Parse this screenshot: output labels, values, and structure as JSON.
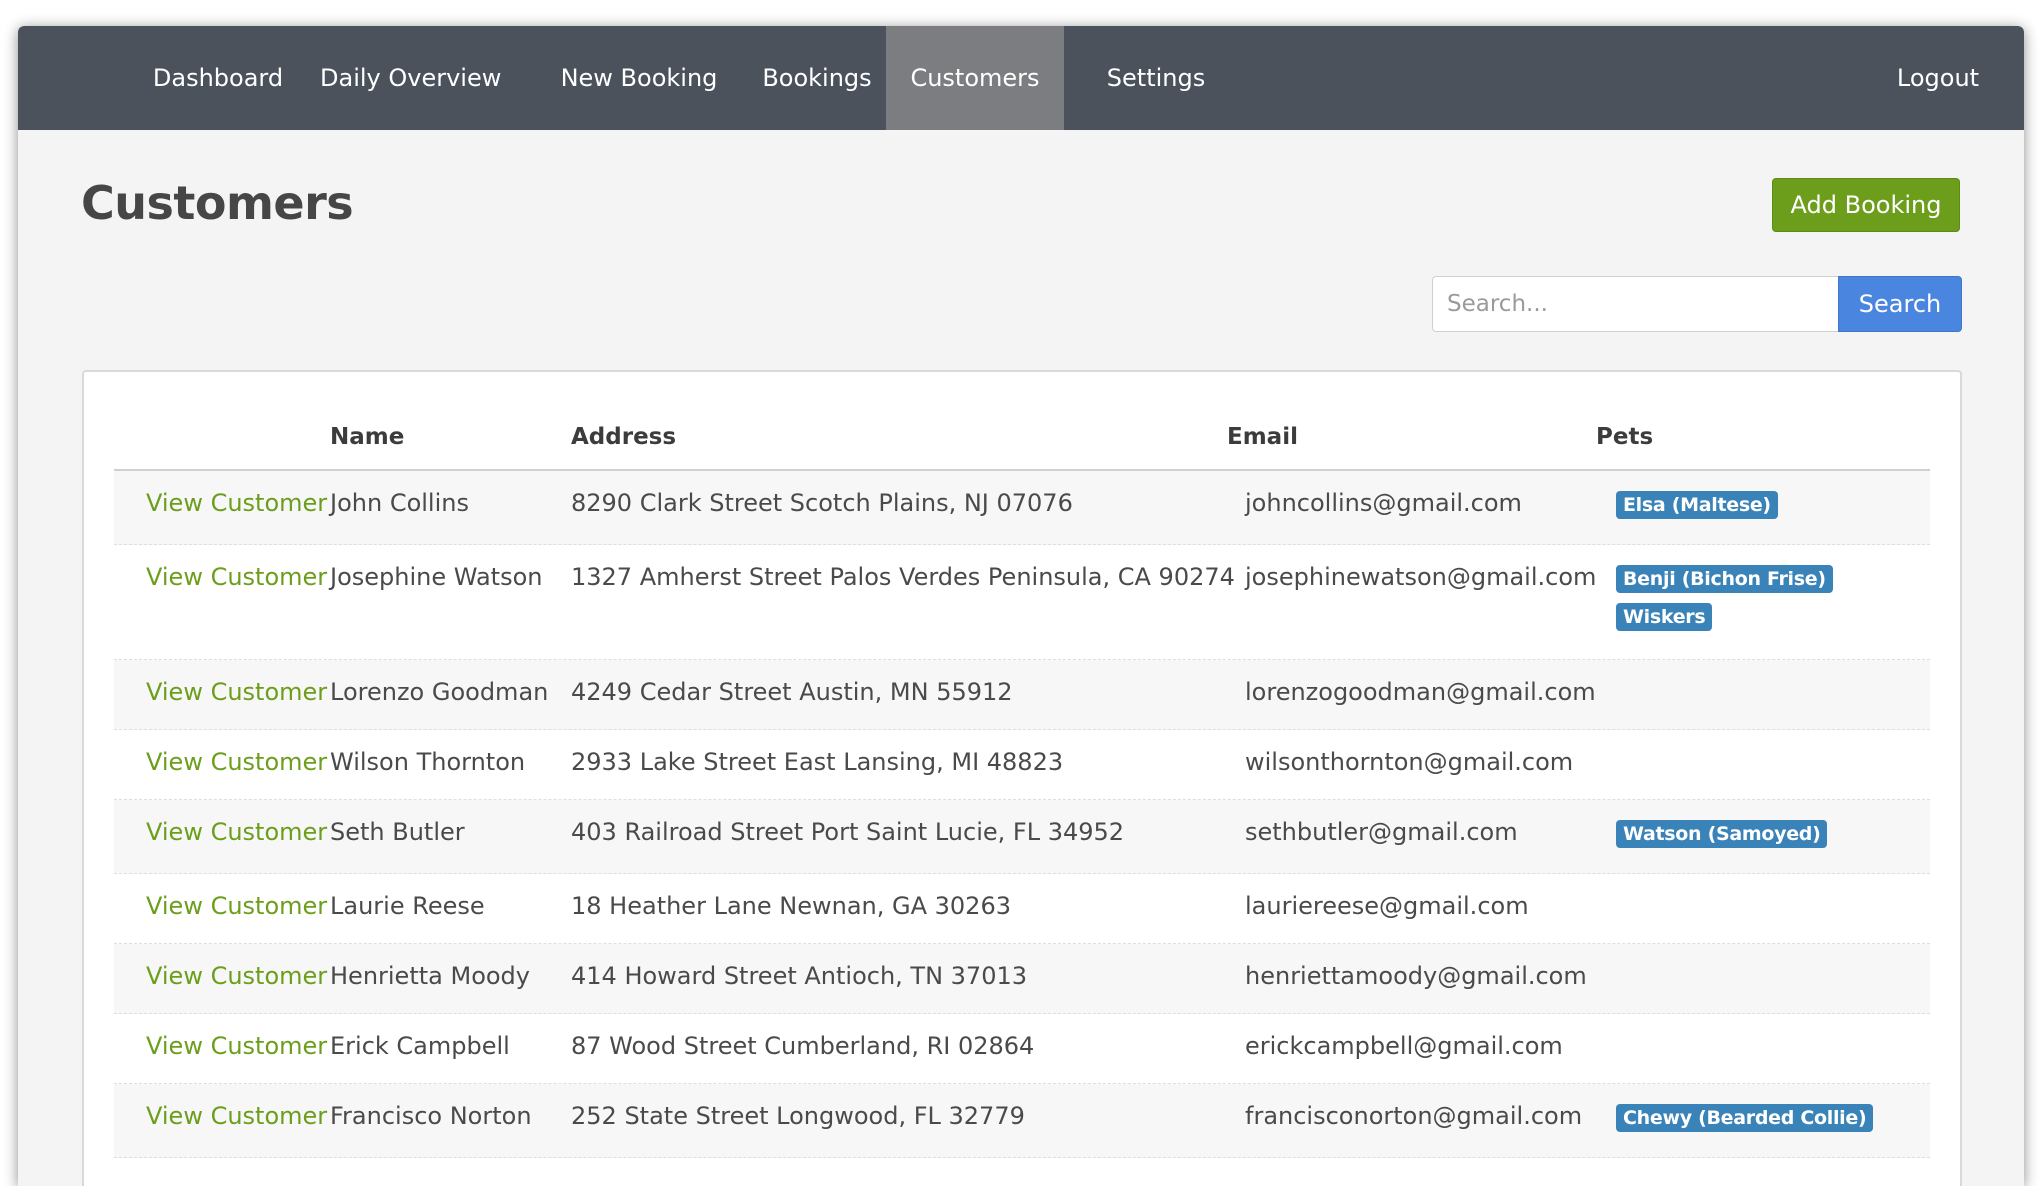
{
  "nav": {
    "items": [
      {
        "label": "Dashboard",
        "active": false
      },
      {
        "label": "Daily Overview",
        "active": false
      },
      {
        "label": "New Booking",
        "active": false
      },
      {
        "label": "Bookings",
        "active": false
      },
      {
        "label": "Customers",
        "active": true
      },
      {
        "label": "Settings",
        "active": false
      }
    ],
    "logout": "Logout"
  },
  "page": {
    "title": "Customers",
    "add_booking_label": "Add Booking"
  },
  "search": {
    "placeholder": "Search...",
    "value": "",
    "button_label": "Search"
  },
  "table": {
    "headers": {
      "action": "",
      "name": "Name",
      "address": "Address",
      "email": "Email",
      "pets": "Pets"
    },
    "view_label": "View Customer",
    "rows": [
      {
        "name": "John Collins",
        "address": "8290 Clark Street Scotch Plains, NJ 07076",
        "email": "johncollins@gmail.com",
        "pets": [
          "Elsa (Maltese)"
        ]
      },
      {
        "name": "Josephine Watson",
        "address": "1327 Amherst Street Palos Verdes Peninsula, CA 90274",
        "email": "josephinewatson@gmail.com",
        "pets": [
          "Benji (Bichon Frise)",
          "Wiskers"
        ]
      },
      {
        "name": "Lorenzo Goodman",
        "address": "4249 Cedar Street Austin, MN 55912",
        "email": "lorenzogoodman@gmail.com",
        "pets": []
      },
      {
        "name": "Wilson Thornton",
        "address": "2933 Lake Street East Lansing, MI 48823",
        "email": "wilsonthornton@gmail.com",
        "pets": []
      },
      {
        "name": "Seth Butler",
        "address": "403 Railroad Street Port Saint Lucie, FL 34952",
        "email": "sethbutler@gmail.com",
        "pets": [
          "Watson (Samoyed)"
        ]
      },
      {
        "name": "Laurie Reese",
        "address": "18 Heather Lane Newnan, GA 30263",
        "email": "lauriereese@gmail.com",
        "pets": []
      },
      {
        "name": "Henrietta Moody",
        "address": "414 Howard Street Antioch, TN 37013",
        "email": "henriettamoody@gmail.com",
        "pets": []
      },
      {
        "name": "Erick Campbell",
        "address": "87 Wood Street Cumberland, RI 02864",
        "email": "erickcampbell@gmail.com",
        "pets": []
      },
      {
        "name": "Francisco Norton",
        "address": "252 State Street Longwood, FL 32779",
        "email": "francisconorton@gmail.com",
        "pets": [
          "Chewy (Bearded Collie)"
        ]
      }
    ]
  },
  "colors": {
    "navbar": "#4b525c",
    "nav_active": "#7c7d80",
    "add_button": "#6c9e1c",
    "search_button": "#4a86e0",
    "link": "#6c9e1c",
    "pet_badge": "#3a83b8"
  }
}
